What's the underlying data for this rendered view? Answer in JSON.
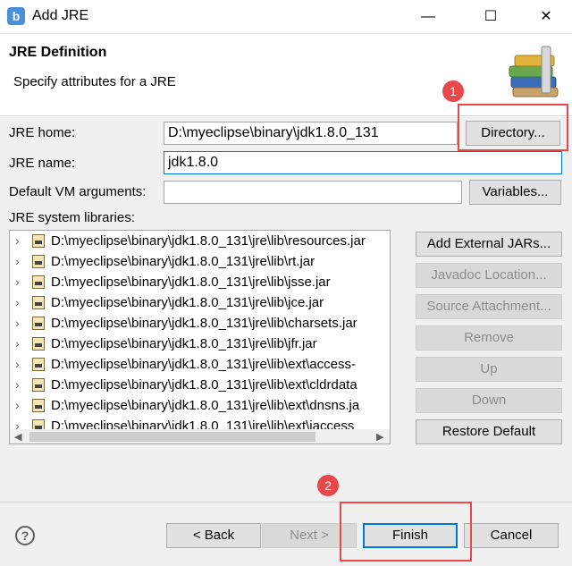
{
  "window": {
    "app_icon": "eclipse-b-icon",
    "title": "Add JRE",
    "minimize": "—",
    "maximize": "☐",
    "close": "✕"
  },
  "header": {
    "title": "JRE Definition",
    "subtitle": "Specify attributes for a JRE",
    "icon": "books-wizard-icon"
  },
  "form": {
    "jre_home_label": "JRE home:",
    "jre_home_value": "D:\\myeclipse\\binary\\jdk1.8.0_131",
    "directory_button": "Directory...",
    "jre_name_label": "JRE name:",
    "jre_name_value": "jdk1.8.0",
    "vm_args_label": "Default VM arguments:",
    "vm_args_value": "",
    "variables_button": "Variables...",
    "libraries_label": "JRE system libraries:"
  },
  "libraries": [
    "D:\\myeclipse\\binary\\jdk1.8.0_131\\jre\\lib\\resources.jar",
    "D:\\myeclipse\\binary\\jdk1.8.0_131\\jre\\lib\\rt.jar",
    "D:\\myeclipse\\binary\\jdk1.8.0_131\\jre\\lib\\jsse.jar",
    "D:\\myeclipse\\binary\\jdk1.8.0_131\\jre\\lib\\jce.jar",
    "D:\\myeclipse\\binary\\jdk1.8.0_131\\jre\\lib\\charsets.jar",
    "D:\\myeclipse\\binary\\jdk1.8.0_131\\jre\\lib\\jfr.jar",
    "D:\\myeclipse\\binary\\jdk1.8.0_131\\jre\\lib\\ext\\access-",
    "D:\\myeclipse\\binary\\jdk1.8.0_131\\jre\\lib\\ext\\cldrdata",
    "D:\\myeclipse\\binary\\jdk1.8.0_131\\jre\\lib\\ext\\dnsns.ja",
    "D:\\myeclipse\\binary\\jdk1.8.0_131\\jre\\lib\\ext\\jaccess"
  ],
  "side_buttons": {
    "add_external": "Add External JARs...",
    "javadoc": "Javadoc Location...",
    "source": "Source Attachment...",
    "remove": "Remove",
    "up": "Up",
    "down": "Down",
    "restore": "Restore Default"
  },
  "footer": {
    "help": "?",
    "back": "< Back",
    "next": "Next >",
    "finish": "Finish",
    "cancel": "Cancel"
  },
  "callouts": {
    "badge1": "1",
    "badge2": "2",
    "color": "#e8484a"
  },
  "colors": {
    "focus": "#0078d7",
    "dialog_bg": "#f0f0f0"
  }
}
